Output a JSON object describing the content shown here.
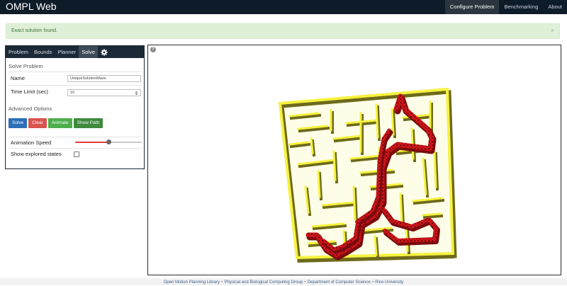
{
  "navbar": {
    "brand": "OMPL Web",
    "links": [
      {
        "label": "Configure Problem",
        "active": true
      },
      {
        "label": "Benchmarking",
        "active": false
      },
      {
        "label": "About",
        "active": false
      }
    ]
  },
  "alert": {
    "message": "Exact solution found.",
    "close": "×"
  },
  "panel": {
    "tabs": [
      "Problem",
      "Bounds",
      "Planner",
      "Solve"
    ],
    "active_tab": "Solve",
    "settings_icon": "gear-icon",
    "section_title": "Solve Problem",
    "name_label": "Name",
    "name_value": "UniqueSolutionMaze",
    "time_label": "Time Limit (sec)",
    "time_value": "10",
    "advanced_title": "Advanced Options",
    "buttons": {
      "solve": "Solve",
      "clear": "Clear",
      "animate": "Animate",
      "show_path": "Show Path"
    },
    "animation_label": "Animation Speed",
    "animation_speed": 0.5,
    "explored_label": "Show explored states",
    "explored_checked": false
  },
  "viewport": {
    "help": "?"
  },
  "footer": {
    "links": [
      "Open Motion Planning Library",
      "Physical and Biological Computing Group",
      "Department of Computer Science",
      "Rice University"
    ],
    "separator": "•"
  },
  "colors": {
    "navbar": "#0e1b29",
    "maze_wall": "#f6f240",
    "maze_side": "#6e6a1b",
    "path": "#e0151b"
  }
}
